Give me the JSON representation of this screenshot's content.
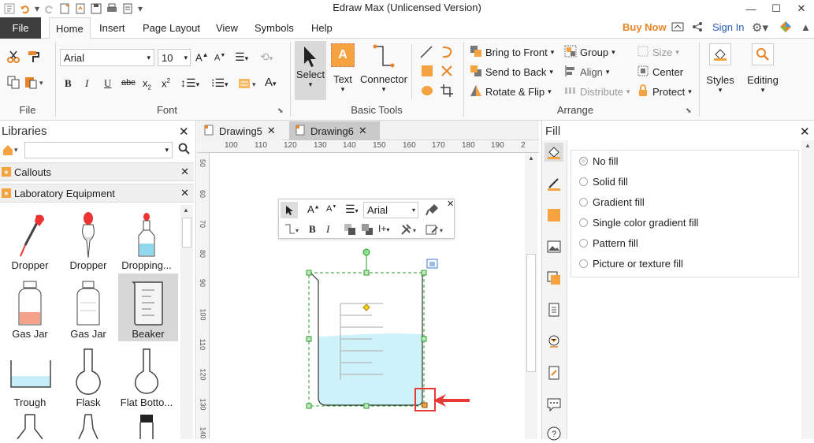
{
  "app": {
    "title": "Edraw Max (Unlicensed Version)"
  },
  "ribbon_tabs": [
    {
      "label": "File"
    },
    {
      "label": "Home"
    },
    {
      "label": "Insert"
    },
    {
      "label": "Page Layout"
    },
    {
      "label": "View"
    },
    {
      "label": "Symbols"
    },
    {
      "label": "Help"
    }
  ],
  "topright": {
    "buy_now": "Buy Now",
    "sign_in": "Sign In"
  },
  "font_group": {
    "font_name": "Arial",
    "font_size": "10",
    "label": "Font"
  },
  "file_group": {
    "label": "File"
  },
  "basic_tools": {
    "select": "Select",
    "text": "Text",
    "connector": "Connector",
    "label": "Basic Tools"
  },
  "arrange": {
    "bring_to_front": "Bring to Front",
    "send_to_back": "Send to Back",
    "rotate_flip": "Rotate & Flip",
    "group": "Group",
    "align": "Align",
    "distribute": "Distribute",
    "size": "Size",
    "center": "Center",
    "protect": "Protect",
    "label": "Arrange"
  },
  "styles": {
    "label": "Styles"
  },
  "editing": {
    "label": "Editing"
  },
  "libraries": {
    "title": "Libraries",
    "categories": [
      "Callouts",
      "Laboratory Equipment"
    ],
    "shapes": [
      {
        "label": "Dropper"
      },
      {
        "label": "Dropper"
      },
      {
        "label": "Dropping..."
      },
      {
        "label": "Gas Jar"
      },
      {
        "label": "Gas Jar"
      },
      {
        "label": "Beaker"
      },
      {
        "label": "Trough"
      },
      {
        "label": "Flask"
      },
      {
        "label": "Flat Botto..."
      }
    ]
  },
  "doc_tabs": [
    {
      "label": "Drawing5"
    },
    {
      "label": "Drawing6"
    }
  ],
  "ruler": {
    "h": [
      "100",
      "110",
      "120",
      "130",
      "140",
      "150",
      "160",
      "170",
      "180",
      "190",
      "2"
    ],
    "v": [
      "50",
      "60",
      "70",
      "80",
      "90",
      "100",
      "110",
      "120",
      "130",
      "140"
    ]
  },
  "mini_toolbar": {
    "font": "Arial"
  },
  "fill": {
    "title": "Fill",
    "options": [
      "No fill",
      "Solid fill",
      "Gradient fill",
      "Single color gradient fill",
      "Pattern fill",
      "Picture or texture fill"
    ],
    "selected": "No fill"
  }
}
